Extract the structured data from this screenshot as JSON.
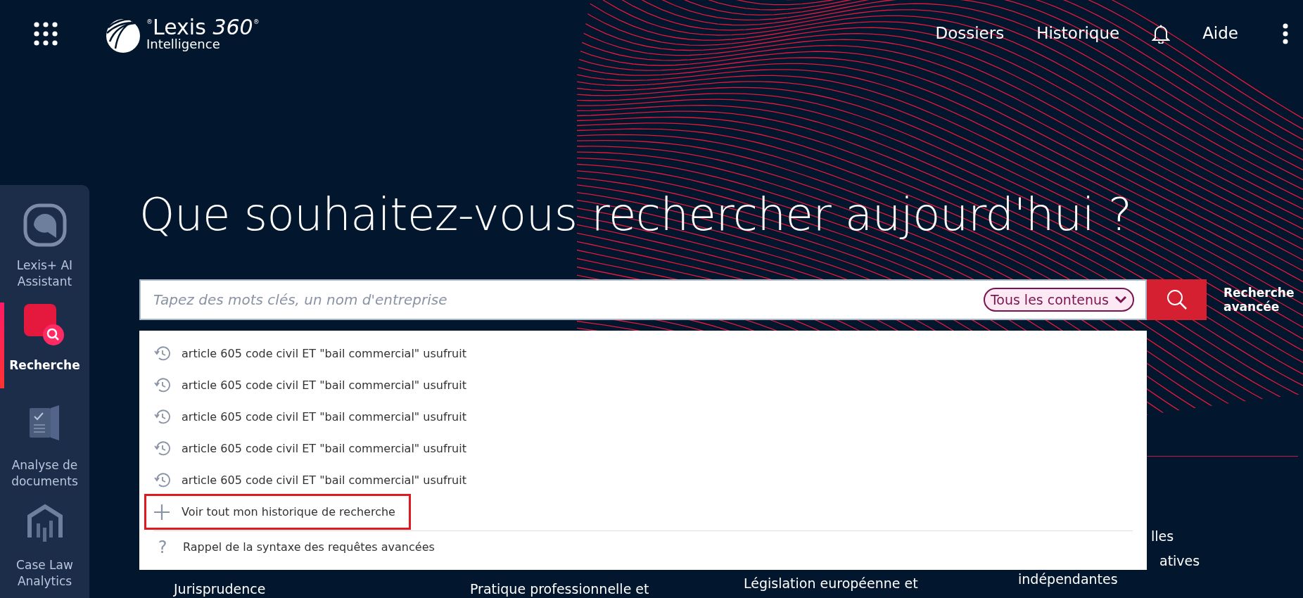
{
  "topbar": {
    "logo": {
      "title": "$^{®}$Lexis *360*$^{®}$",
      "tagline": "Intelligence"
    },
    "nav": [
      {
        "kind": "link",
        "label": "Dossiers"
      },
      {
        "kind": "link",
        "label": "Historique"
      },
      {
        "kind": "bell"
      },
      {
        "kind": "link",
        "label": "Aide"
      },
      {
        "kind": "more"
      }
    ]
  },
  "sidebar": {
    "items": [
      {
        "kind": "assistant",
        "label": "Lexis+ AI Assistant",
        "selected": false
      },
      {
        "kind": "search",
        "label": "Recherche",
        "selected": true
      },
      {
        "kind": "documents",
        "label": "Analyse de documents",
        "selected": false
      },
      {
        "kind": "analytics",
        "label": "Case Law Analytics",
        "selected": false
      }
    ]
  },
  "heading": "Que souhaitez-vous rechercher aujourd'hui ?",
  "search": {
    "placeholder": "Tapez des mots clés, un nom d'entreprise",
    "scope": "Tous les contenus",
    "advanced": "Recherche avancée"
  },
  "suggestions": {
    "history": [
      "article 605 code civil ET \"bail commercial\" usufruit",
      "article 605 code civil ET \"bail commercial\" usufruit",
      "article 605 code civil ET \"bail commercial\" usufruit",
      "article 605 code civil ET \"bail commercial\" usufruit",
      "article 605 code civil ET \"bail commercial\" usufruit"
    ],
    "actions": [
      {
        "kind": "more",
        "label": "Voir tout mon historique de recherche",
        "highlighted": true
      },
      {
        "kind": "help",
        "symbol": "?",
        "label": "Rappel de la syntaxe des requêtes avancées",
        "highlighted": false
      }
    ]
  },
  "background_columns": [
    [
      "Jurisprudence"
    ],
    [
      "Pratique professionnelle et"
    ],
    [
      "Législation européenne et"
    ],
    [
      "lles",
      "atives",
      "indépendantes"
    ]
  ]
}
